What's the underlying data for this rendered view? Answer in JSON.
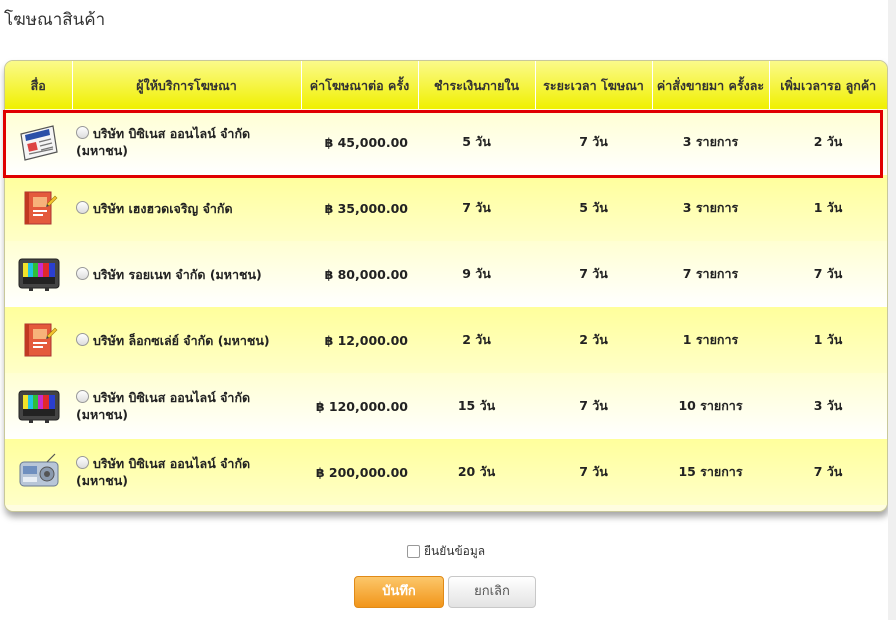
{
  "page_title": "โฆษณาสินค้า",
  "columns": [
    "สื่อ",
    "ผู้ให้บริการโฆษณา",
    "ค่าโฆษณาต่อ ครั้ง",
    "ชำระเงินภายใน",
    "ระยะเวลา โฆษณา",
    "ค่าสั่งขายมา ครั้งละ",
    "เพิ่มเวลารอ ลูกค้า"
  ],
  "rows": [
    {
      "media_icon": "newspaper-icon",
      "provider": "บริษัท บิซิเนส ออนไลน์ จำกัด (มหาชน)",
      "price": "฿ 45,000.00",
      "pay_within": "5 วัน",
      "duration": "7 วัน",
      "orders": "3 รายการ",
      "extra_wait": "2 วัน"
    },
    {
      "media_icon": "magazine-icon",
      "provider": "บริษัท เฮงฮวดเจริญ จำกัด",
      "price": "฿ 35,000.00",
      "pay_within": "7 วัน",
      "duration": "5 วัน",
      "orders": "3 รายการ",
      "extra_wait": "1 วัน"
    },
    {
      "media_icon": "television-icon",
      "provider": "บริษัท รอยเนท จำกัด (มหาชน)",
      "price": "฿ 80,000.00",
      "pay_within": "9 วัน",
      "duration": "7 วัน",
      "orders": "7 รายการ",
      "extra_wait": "7 วัน"
    },
    {
      "media_icon": "magazine-icon",
      "provider": "บริษัท ล็อกซเล่ย์ จำกัด (มหาชน)",
      "price": "฿ 12,000.00",
      "pay_within": "2 วัน",
      "duration": "2 วัน",
      "orders": "1 รายการ",
      "extra_wait": "1 วัน"
    },
    {
      "media_icon": "television-icon",
      "provider": "บริษัท บิซิเนส ออนไลน์ จำกัด (มหาชน)",
      "price": "฿ 120,000.00",
      "pay_within": "15 วัน",
      "duration": "7 วัน",
      "orders": "10 รายการ",
      "extra_wait": "3 วัน"
    },
    {
      "media_icon": "radio-icon",
      "provider": "บริษัท บิซิเนส ออนไลน์ จำกัด (มหาชน)",
      "price": "฿ 200,000.00",
      "pay_within": "20 วัน",
      "duration": "7 วัน",
      "orders": "15 รายการ",
      "extra_wait": "7 วัน"
    }
  ],
  "confirm_label": "ยืนยันข้อมูล",
  "buttons": {
    "save": "บันทึก",
    "cancel": "ยกเลิก"
  },
  "colors": {
    "header": "#f0f000",
    "highlight": "#e00000",
    "save": "#f1951a"
  }
}
